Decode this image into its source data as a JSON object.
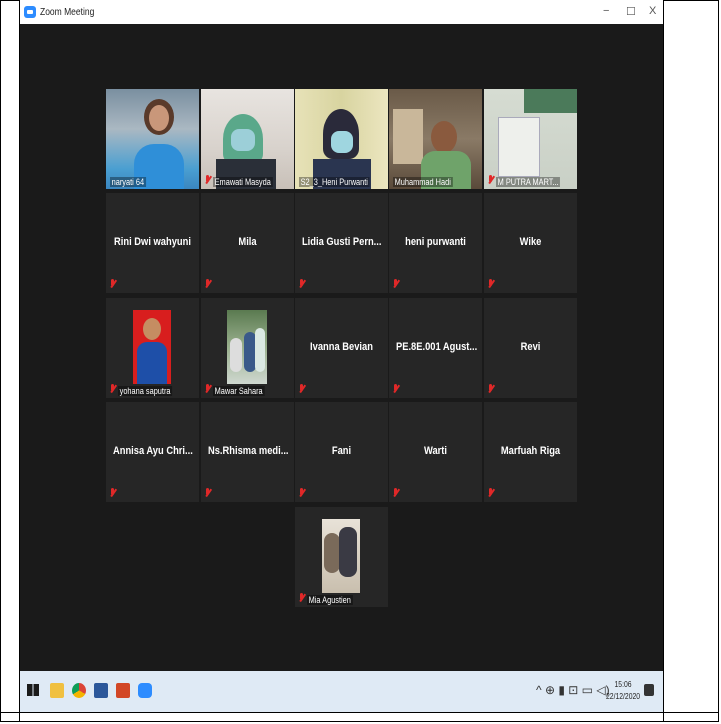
{
  "window": {
    "title": "Zoom Meeting",
    "controls": [
      "−",
      "☐",
      "X"
    ]
  },
  "participants": [
    {
      "name": "naryati 64",
      "video": true,
      "active": true,
      "muted": false
    },
    {
      "name": "Emawati Masyda",
      "video": true,
      "muted": true
    },
    {
      "name": "S2_3_Heni Purwanti",
      "video": true,
      "muted": false
    },
    {
      "name": "Muhammad Hadi",
      "video": true,
      "muted": false
    },
    {
      "name": "M PUTRA MART...",
      "video": true,
      "muted": true
    },
    {
      "name": "Rini Dwi wahyuni",
      "video": false,
      "muted": true
    },
    {
      "name": "Mila",
      "video": false,
      "muted": true
    },
    {
      "name": "Lidia Gusti Pern...",
      "video": false,
      "muted": true
    },
    {
      "name": "heni purwanti",
      "video": false,
      "muted": true
    },
    {
      "name": "Wike",
      "video": false,
      "muted": true
    },
    {
      "name": "yohana saputra",
      "video": false,
      "photo": true,
      "muted": true
    },
    {
      "name": "Mawar Sahara",
      "video": false,
      "photo": true,
      "muted": true
    },
    {
      "name": "Ivanna Bevian",
      "video": false,
      "muted": true
    },
    {
      "name": "PE.8E.001 Agust...",
      "video": false,
      "muted": true
    },
    {
      "name": "Revi",
      "video": false,
      "muted": true
    },
    {
      "name": "Annisa Ayu Chri...",
      "video": false,
      "muted": true
    },
    {
      "name": "Ns.Rhisma medi...",
      "video": false,
      "muted": true
    },
    {
      "name": "Fani",
      "video": false,
      "muted": true
    },
    {
      "name": "Warti",
      "video": false,
      "muted": true
    },
    {
      "name": "Marfuah Riga",
      "video": false,
      "muted": true
    },
    {
      "name": "Mia Agustien",
      "video": false,
      "photo": true,
      "muted": true
    }
  ],
  "taskbar": {
    "apps": [
      "windows-start-icon",
      "file-explorer-icon",
      "chrome-icon",
      "word-icon",
      "powerpoint-icon",
      "zoom-icon"
    ],
    "tray_symbols": "^ ⊕ ▮ ⊡ ▭ ◁)",
    "time": "15:06",
    "date": "22/12/2020"
  },
  "colors": {
    "background": "#1a1a1a",
    "tile": "#262626",
    "active_border": "#d6e26d",
    "mute_red": "#e02828",
    "taskbar": "#dfeaf5"
  }
}
